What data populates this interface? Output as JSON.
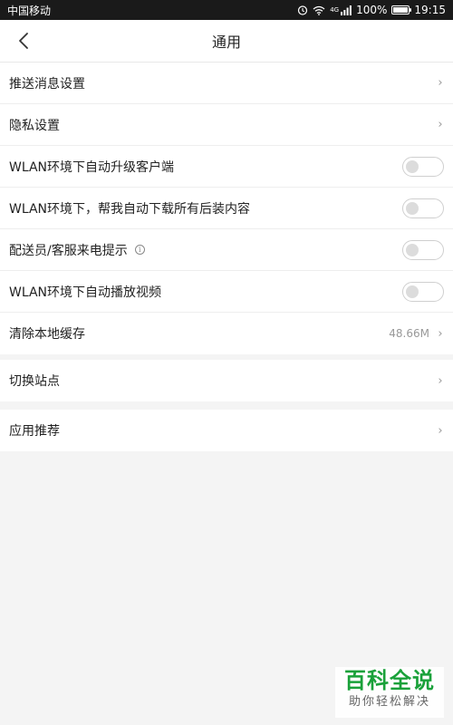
{
  "status_bar": {
    "carrier": "中国移动",
    "battery": "100%",
    "time": "19:15",
    "network": "4G",
    "battery_level": 1.0
  },
  "nav": {
    "title": "通用"
  },
  "settings": {
    "group1": [
      {
        "label": "推送消息设置",
        "type": "link"
      },
      {
        "label": "隐私设置",
        "type": "link"
      },
      {
        "label": "WLAN环境下自动升级客户端",
        "type": "toggle",
        "on": false
      },
      {
        "label": "WLAN环境下，帮我自动下载所有后装内容",
        "type": "toggle",
        "on": false
      },
      {
        "label": "配送员/客服来电提示",
        "type": "toggle",
        "on": false,
        "info_icon": true
      },
      {
        "label": "WLAN环境下自动播放视频",
        "type": "toggle",
        "on": false
      },
      {
        "label": "清除本地缓存",
        "type": "link",
        "value": "48.66M"
      }
    ],
    "group2": [
      {
        "label": "切换站点",
        "type": "link"
      }
    ],
    "group3": [
      {
        "label": "应用推荐",
        "type": "link"
      }
    ]
  },
  "watermark": {
    "main": "百科全说",
    "sub": "助你轻松解决"
  },
  "colors": {
    "background": "#f4f4f4",
    "status_bar": "#1a1a1a",
    "watermark_green": "#1aa13a"
  }
}
